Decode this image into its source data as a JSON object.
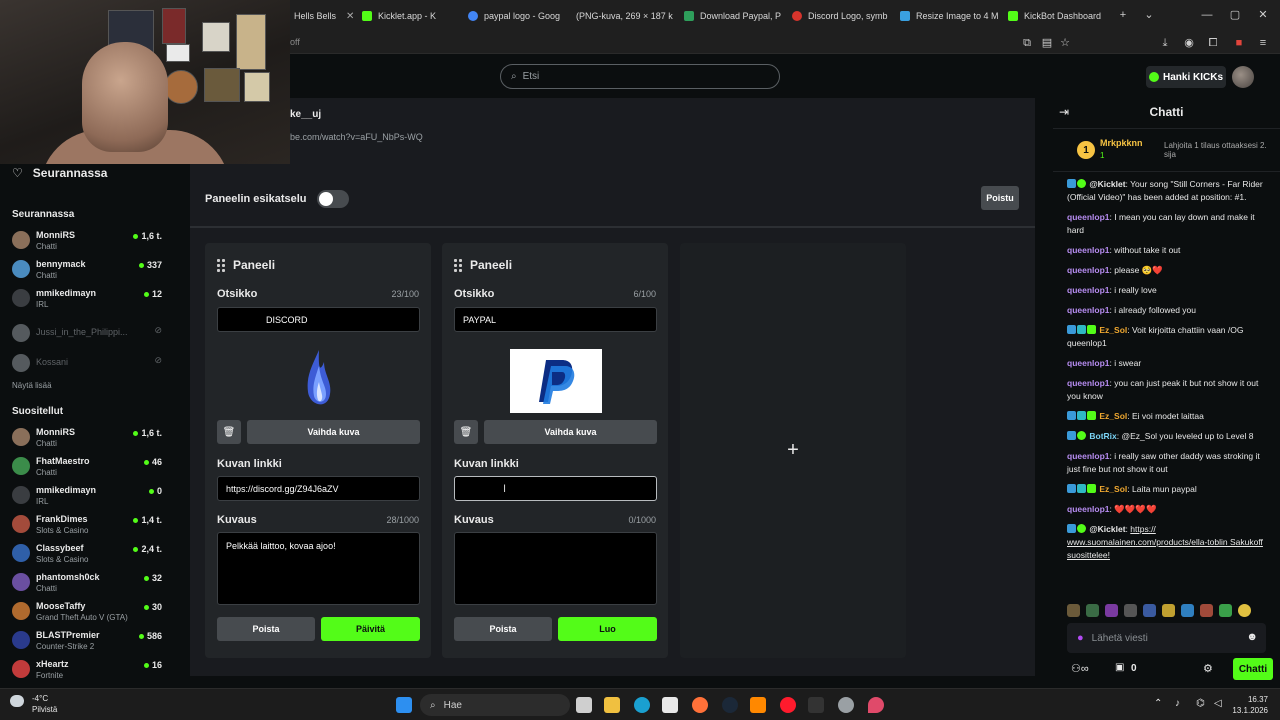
{
  "browser": {
    "tabs": [
      {
        "label": "Hells Bells",
        "color": "#c23b3b"
      },
      {
        "label": "Kicklet.app - K",
        "color": "#53fc18"
      },
      {
        "label": "paypal logo - Goog",
        "color": "#4285f4"
      },
      {
        "label": "(PNG-kuva, 269 × 187 k",
        "color": "#888888"
      },
      {
        "label": "Download Paypal, P",
        "color": "#2e9e5b"
      },
      {
        "label": "Discord Logo, symb",
        "color": "#d6342c"
      },
      {
        "label": "Resize Image to 4 M",
        "color": "#3aa0e0"
      },
      {
        "label": "KickBot Dashboard",
        "color": "#53fc18"
      }
    ],
    "address_fragment": "off"
  },
  "header": {
    "search_placeholder": "Etsi",
    "kicks_label": "Hanki KICKs"
  },
  "strip": {
    "title_fragment": "ke__uj",
    "url_fragment": "be.com/watch?v=aFU_NbPs-WQ"
  },
  "sidebar": {
    "follow_title": "Seurannassa",
    "following_label": "Seurannassa",
    "following": [
      {
        "name": "MonniRS",
        "category": "Chatti",
        "viewers": "1,6 t.",
        "color": "#8a6f5a"
      },
      {
        "name": "bennymack",
        "category": "Chatti",
        "viewers": "337",
        "color": "#4a8bbf"
      },
      {
        "name": "mmikedimayn",
        "category": "IRL",
        "viewers": "12",
        "color": "#3a3d41"
      },
      {
        "name": "Jussi_in_the_Philippi...",
        "category": "",
        "viewers": "",
        "color": "#555a5e",
        "offline": true
      },
      {
        "name": "Kossani",
        "category": "",
        "viewers": "",
        "color": "#555a5e",
        "offline": true
      }
    ],
    "show_more": "Näytä lisää",
    "recommended_label": "Suositellut",
    "recommended": [
      {
        "name": "MonniRS",
        "category": "Chatti",
        "viewers": "1,6 t.",
        "color": "#8a6f5a"
      },
      {
        "name": "FhatMaestro",
        "category": "Chatti",
        "viewers": "46",
        "color": "#3b8c4a"
      },
      {
        "name": "mmikedimayn",
        "category": "IRL",
        "viewers": "0",
        "color": "#3a3d41"
      },
      {
        "name": "FrankDimes",
        "category": "Slots & Casino",
        "viewers": "1,4 t.",
        "color": "#a34b3b"
      },
      {
        "name": "Classybeef",
        "category": "Slots & Casino",
        "viewers": "2,4 t.",
        "color": "#2f5fa8"
      },
      {
        "name": "phantomsh0ck",
        "category": "Chatti",
        "viewers": "32",
        "color": "#6a4fa0"
      },
      {
        "name": "MooseTaffy",
        "category": "Grand Theft Auto V (GTA)",
        "viewers": "30",
        "color": "#b06a2e"
      },
      {
        "name": "BLASTPremier",
        "category": "Counter-Strike 2",
        "viewers": "586",
        "color": "#2a3a8c"
      },
      {
        "name": "xHeartz",
        "category": "Fortnite",
        "viewers": "16",
        "color": "#c23b3b"
      }
    ]
  },
  "main": {
    "preview_label": "Paneelin esikatselu",
    "exit_label": "Poistu",
    "panels": [
      {
        "heading": "Paneeli",
        "title_label": "Otsikko",
        "title_count": "23/100",
        "title_value": "DISCORD",
        "change_image": "Vaihda kuva",
        "link_label": "Kuvan linkki",
        "link_value": "https://discord.gg/Z94J6aZV",
        "desc_label": "Kuvaus",
        "desc_count": "28/1000",
        "desc_value": "Pelkkää laittoo, kovaa ajoo!",
        "delete_label": "Poista",
        "primary_label": "Päivitä"
      },
      {
        "heading": "Paneeli",
        "title_label": "Otsikko",
        "title_count": "6/100",
        "title_value": "PAYPAL",
        "change_image": "Vaihda kuva",
        "link_label": "Kuvan linkki",
        "link_value": "",
        "desc_label": "Kuvaus",
        "desc_count": "0/1000",
        "desc_value": "",
        "delete_label": "Poista",
        "primary_label": "Luo"
      }
    ]
  },
  "chat": {
    "title": "Chatti",
    "top_gifter": {
      "rank": "1",
      "name": "Mrkpkknn",
      "count": "1",
      "note": "Lahjoita 1 tilaus ottaaksesi 2. sija"
    },
    "messages": [
      {
        "user": "@Kicklet",
        "color": "#7ad3f5",
        "text": "Your song \"Still Corners - Far Rider (Official Video)\" has been added at position: #1."
      },
      {
        "user": "queenlop1",
        "color": "#b68cf0",
        "text": "I mean you can lay down and make it hard"
      },
      {
        "user": "queenlop1",
        "color": "#b68cf0",
        "text": "without take it out"
      },
      {
        "user": "queenlop1",
        "color": "#b68cf0",
        "text": "please 🥺❤️"
      },
      {
        "user": "queenlop1",
        "color": "#b68cf0",
        "text": "i really love"
      },
      {
        "user": "queenlop1",
        "color": "#b68cf0",
        "text": "i already followed you"
      },
      {
        "user": "Ez_Sol",
        "color": "#f0a830",
        "text": "Voit kirjoitta chattiin vaan /OG queenlop1"
      },
      {
        "user": "queenlop1",
        "color": "#b68cf0",
        "text": "i swear"
      },
      {
        "user": "queenlop1",
        "color": "#b68cf0",
        "text": "you can just peak it but not show it out you know"
      },
      {
        "user": "Ez_Sol",
        "color": "#f0a830",
        "text": "Ei voi modet laittaa"
      },
      {
        "user": "BotRix",
        "color": "#7ad3f5",
        "text": "@Ez_Sol you leveled up to Level 8"
      },
      {
        "user": "queenlop1",
        "color": "#b68cf0",
        "text": "i really saw other daddy was stroking it just fine but not show it out"
      },
      {
        "user": "Ez_Sol",
        "color": "#f0a830",
        "text": "Laita mun paypal"
      },
      {
        "user": "queenlop1",
        "color": "#b68cf0",
        "text": "❤️❤️❤️❤️"
      },
      {
        "user": "@Kicklet",
        "color": "#7ad3f5",
        "text": "https:// www.suomalainen.com/products/ella-toblin Sakukoff suosittelee!"
      }
    ],
    "input_placeholder": "Lähetä viesti",
    "points": "0",
    "send_label": "Chatti"
  },
  "taskbar": {
    "weather_temp": "-4°C",
    "weather_desc": "Pilvistä",
    "search_label": "Hae",
    "time": "16.37",
    "date": "13.1.2026"
  },
  "colors": {
    "accent": "#53fc18",
    "gold": "#f6c343"
  }
}
